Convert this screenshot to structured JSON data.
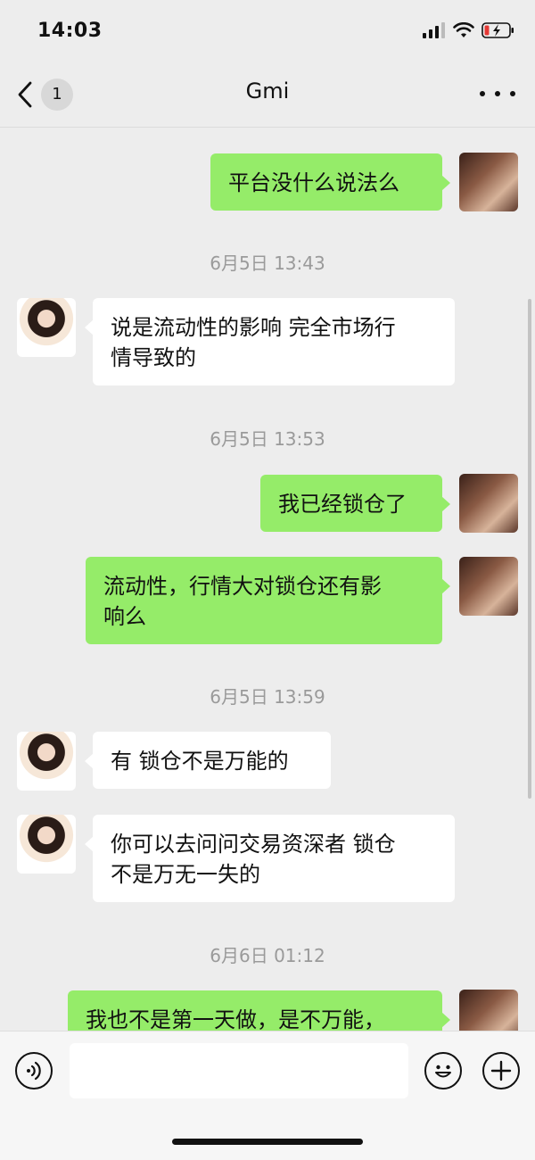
{
  "status_bar": {
    "time": "14:03",
    "icons": [
      "signal-icon",
      "wifi-icon",
      "battery-charging-icon"
    ]
  },
  "nav": {
    "back_icon": "chevron-left-icon",
    "unread_count": "1",
    "title": "Gmi",
    "more_icon": "more-icon"
  },
  "messages": [
    {
      "kind": "self",
      "text": "平台没什么说法么"
    },
    {
      "kind": "time",
      "text": "6月5日 13:43"
    },
    {
      "kind": "other",
      "text": "说是流动性的影响 完全市场行\n情导致的"
    },
    {
      "kind": "time",
      "text": "6月5日 13:53"
    },
    {
      "kind": "self",
      "text": "我已经锁仓了"
    },
    {
      "kind": "self",
      "text": "流动性，行情大对锁仓还有影\n响么"
    },
    {
      "kind": "time",
      "text": "6月5日 13:59"
    },
    {
      "kind": "other",
      "text": "有 锁仓不是万能的"
    },
    {
      "kind": "other",
      "text": "你可以去问问交易资深者 锁仓\n不是万无一失的"
    },
    {
      "kind": "time",
      "text": "6月6日 01:12"
    },
    {
      "kind": "self",
      "text": "我也不是第一天做，是不万能，"
    }
  ],
  "input_bar": {
    "voice_icon": "voice-icon",
    "input_value": "",
    "emoji_icon": "emoji-icon",
    "plus_icon": "plus-icon"
  },
  "colors": {
    "self_bubble": "#95ec69",
    "other_bubble": "#ffffff",
    "background": "#ededed"
  }
}
